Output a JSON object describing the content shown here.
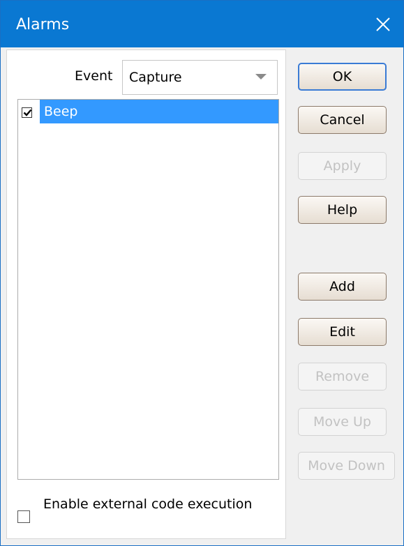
{
  "window": {
    "title": "Alarms"
  },
  "event": {
    "label": "Event",
    "selected": "Capture"
  },
  "alarms": [
    {
      "label": "Beep",
      "checked": true,
      "selected": true
    }
  ],
  "options": {
    "external_code_label": "Enable external code execution",
    "external_code_checked": false
  },
  "buttons": {
    "ok": "OK",
    "cancel": "Cancel",
    "apply": "Apply",
    "help": "Help",
    "add": "Add",
    "edit": "Edit",
    "remove": "Remove",
    "move_up": "Move Up",
    "move_down": "Move Down"
  },
  "colors": {
    "titlebar": "#0a78d2",
    "selection": "#3399ff"
  }
}
